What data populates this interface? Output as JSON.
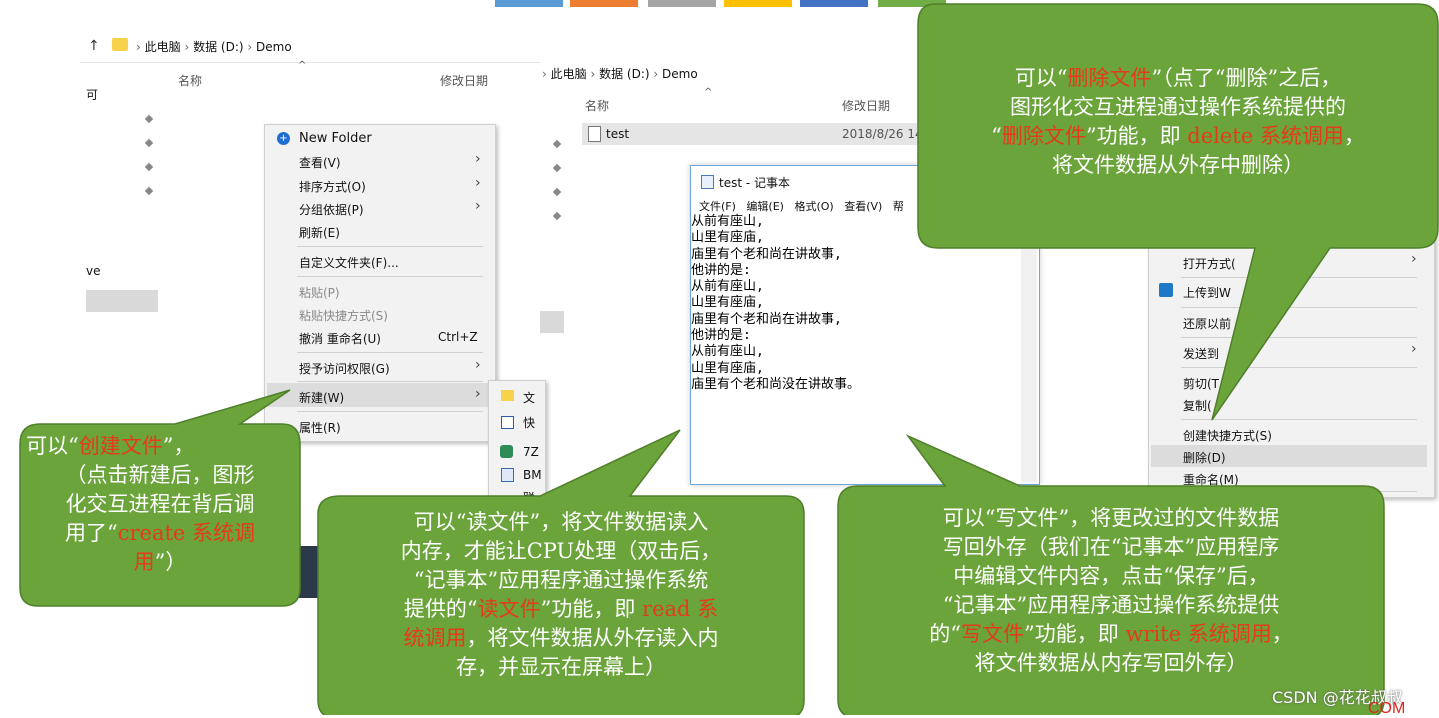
{
  "top_blocks": [
    "#5b9bd5",
    "#ed7d31",
    "#a5a5a5",
    "#ffc000",
    "#4472c4",
    "#70ad47"
  ],
  "explorer1": {
    "path": [
      "此电脑",
      "数据 (D:)",
      "Demo"
    ],
    "col_name": "名称",
    "col_date": "修改日期",
    "side_label_1": "可",
    "side_label_2": "ve"
  },
  "explorer2": {
    "path": [
      "此电脑",
      "数据 (D:)",
      "Demo"
    ],
    "col_name": "名称",
    "col_date": "修改日期",
    "file_name": "test",
    "file_date": "2018/8/26 14"
  },
  "context_menu": {
    "items": [
      {
        "label": "New Folder"
      },
      {
        "label": "查看(V)"
      },
      {
        "label": "排序方式(O)"
      },
      {
        "label": "分组依据(P)"
      },
      {
        "label": "刷新(E)"
      },
      {
        "label": "自定义文件夹(F)..."
      },
      {
        "label": "粘贴(P)"
      },
      {
        "label": "粘贴快捷方式(S)"
      },
      {
        "label": "撤消 重命名(U)",
        "shortcut": "Ctrl+Z"
      },
      {
        "label": "授予访问权限(G)"
      },
      {
        "label": "新建(W)"
      },
      {
        "label": "属性(R)"
      }
    ]
  },
  "submenu": {
    "items": [
      "文",
      "快",
      "7Z",
      "BM",
      "联"
    ]
  },
  "notepad": {
    "title": "test - 记事本",
    "menus": [
      "文件(F)",
      "编辑(E)",
      "格式(O)",
      "查看(V)",
      "帮"
    ],
    "lines": [
      "从前有座山,",
      "山里有座庙,",
      "庙里有个老和尚在讲故事,",
      "他讲的是:",
      "从前有座山,",
      "山里有座庙,",
      "庙里有个老和尚在讲故事,",
      "他讲的是:",
      "从前有座山,",
      "山里有座庙,",
      "庙里有个老和尚没在讲故事。"
    ]
  },
  "right_menu": {
    "items": [
      "打开方式(",
      "上传到W",
      "还原以前",
      "发送到",
      "剪切(T",
      "复制(",
      "创建快捷方式(S)",
      "删除(D)",
      "重命名(M)"
    ]
  },
  "callouts": {
    "delete": {
      "p1": "可以“",
      "r1": "删除文件",
      "p2": "”（点了“删除”之后，",
      "p3": "图形化交互进程通过操作系统提供的",
      "p4": "“",
      "r2": "删除文件",
      "p5": "”功能，即 ",
      "r3": "delete 系统调用",
      "p6": "，",
      "p7": "将文件数据从外存中删除）"
    },
    "create": {
      "p1": "可以“",
      "r1": "创建文件",
      "p2": "”，",
      "p3": "（点击新建后，图形",
      "p4": "化交互进程在背后调",
      "p5": "用了“",
      "r2": "create 系统调",
      "r3": "用",
      "p6": "”）"
    },
    "read": {
      "p1": "可以“读文件”，将文件数据读入",
      "p2": "内存，才能让CPU处理（双击后，",
      "p3": "“记事本”应用程序通过操作系统",
      "p4": "提供的“",
      "r1": "读文件",
      "p5": "”功能，即 ",
      "r2": "read 系",
      "r3": "统调用",
      "p6": "，将文件数据从外存读入内",
      "p7": "存，并显示在屏幕上）"
    },
    "write": {
      "p1": "可以“写文件”，将更改过的文件数据",
      "p2": "写回外存（我们在“记事本”应用程序",
      "p3": "中编辑文件内容，点击“保存”后，",
      "p4": "“记事本”应用程序通过操作系统提供",
      "p5": "的“",
      "r1": "写文件",
      "p6": "”功能，即 ",
      "r2": "write 系统调用",
      "p7": "，",
      "p8": "将文件数据从内存写回外存）"
    }
  },
  "watermark": "CSDN @花花叔叔",
  "corner_text": "COM"
}
